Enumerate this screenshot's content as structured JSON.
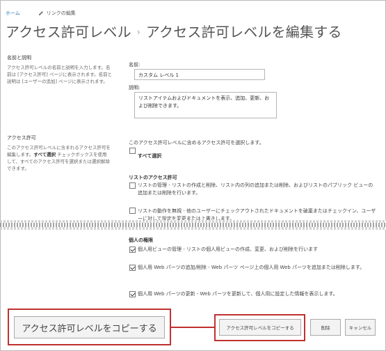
{
  "nav": {
    "home": "ホーム",
    "edit_links": "リンクの編集"
  },
  "title": {
    "part1": "アクセス許可レベル",
    "separator": "›",
    "part2": "アクセス許可レベルを編集する"
  },
  "name_section": {
    "heading": "名前と説明",
    "description": "アクセス許可レベルの名前と説明を入力します。名前は [アクセス許可] ページに表示されます。名前と説明は [ユーザーの追加] ページに表示されます。",
    "name_label": "名前:",
    "name_value": "カスタム レベル 1",
    "desc_label": "説明:",
    "desc_value": "リストアイテムおよびドキュメントを表示、追加、更新、および削除できます。"
  },
  "perm_section": {
    "heading": "アクセス許可",
    "description_pre": "このアクセス許可レベルに含まれるアクセス許可を編集します。",
    "description_bold": "すべて選択",
    "description_post": " チェックボックスを使用して、すべてのアクセス許可を選択または選択解除できます。",
    "intro": "このアクセス許可レベルに含めるアクセス許可を選択します。",
    "select_all": "すべて選択"
  },
  "list_perms": {
    "heading": "リストのアクセス許可",
    "items": [
      {
        "text": "リストの管理 - リストの作成と削除、リスト内の列の追加または削除、およびリストのパブリック ビューの追加または削除を行います。",
        "checked": false
      },
      {
        "text": "リストの動作を無視 - 他のユーザーにチェックアウトされたドキュメントを破棄またはチェックイン、ユーザーに対して設定を変更または上書きします。",
        "checked": false
      }
    ]
  },
  "personal_perms": {
    "heading": "個人の権限",
    "items": [
      {
        "text": "個人用ビューの管理 - リストの個人用ビューの作成、変更、および削除を行います",
        "checked": true
      },
      {
        "text": "個人用 Web パーツの追加/削除 - Web パーツ ページ上の個人用 Web パーツを追加または削除します。",
        "checked": true
      },
      {
        "text": "個人用 Web パーツの更新 - Web パーツを更新して、個人用に設定した情報を表示します。",
        "checked": true
      }
    ]
  },
  "buttons": {
    "copy": "アクセス許可レベルをコピーする",
    "delete": "削除",
    "cancel": "キャンセル",
    "copy_zoom": "アクセス許可レベルをコピーする"
  },
  "colors": {
    "highlight": "#c0302f",
    "link": "#2a7ab8"
  },
  "icons": {
    "edit": "pencil-icon"
  }
}
